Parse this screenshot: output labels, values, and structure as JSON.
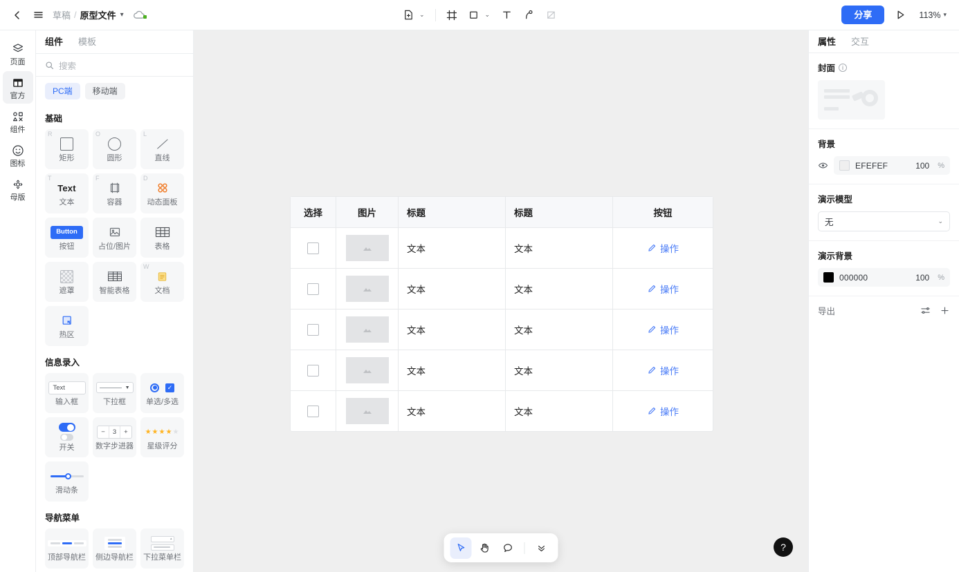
{
  "topbar": {
    "back_icon": "chevron-left-icon",
    "menu_icon": "hamburger-menu-icon",
    "breadcrumb_root": "草稿",
    "breadcrumb_sep": "/",
    "breadcrumb_current": "原型文件",
    "breadcrumb_chevron": "▾",
    "cloud_icon": "cloud-saved-icon",
    "tools": [
      {
        "name": "insert-file-icon",
        "label": "插入"
      },
      {
        "name": "frame-icon",
        "label": "画板"
      },
      {
        "name": "rectangle-icon",
        "label": "矩形"
      },
      {
        "name": "text-icon",
        "label": "文本"
      },
      {
        "name": "pen-icon",
        "label": "钢笔"
      },
      {
        "name": "slice-icon",
        "label": "切图"
      }
    ],
    "share_label": "分享",
    "preview_icon": "play-icon",
    "zoom_level": "113%",
    "zoom_chevron": "▾"
  },
  "rail": {
    "items": [
      {
        "icon": "layers-icon",
        "label": "页面",
        "active": false
      },
      {
        "icon": "official-library-icon",
        "label": "官方",
        "active": true
      },
      {
        "icon": "components-icon",
        "label": "组件",
        "active": false
      },
      {
        "icon": "smiley-icon",
        "label": "图标",
        "active": false
      },
      {
        "icon": "master-icon",
        "label": "母版",
        "active": false
      }
    ]
  },
  "panel": {
    "tabs": [
      {
        "label": "组件",
        "active": true
      },
      {
        "label": "模板",
        "active": false
      }
    ],
    "search_placeholder": "搜索",
    "search_icon": "search-icon",
    "segments": [
      {
        "label": "PC端",
        "active": true
      },
      {
        "label": "移动端",
        "active": false
      }
    ],
    "sections": [
      {
        "title": "基础",
        "items": [
          {
            "label": "矩形",
            "key": "R",
            "art": "rect"
          },
          {
            "label": "圆形",
            "key": "O",
            "art": "circle"
          },
          {
            "label": "直线",
            "key": "L",
            "art": "line"
          },
          {
            "label": "文本",
            "key": "T",
            "art": "text"
          },
          {
            "label": "容器",
            "key": "F",
            "art": "frame"
          },
          {
            "label": "动态面板",
            "key": "D",
            "art": "panel"
          },
          {
            "label": "按钮",
            "key": "",
            "art": "button"
          },
          {
            "label": "占位/图片",
            "key": "",
            "art": "image"
          },
          {
            "label": "表格",
            "key": "",
            "art": "table"
          },
          {
            "label": "遮罩",
            "key": "",
            "art": "mask"
          },
          {
            "label": "智能表格",
            "key": "",
            "art": "smarttable"
          },
          {
            "label": "文档",
            "key": "W",
            "art": "doc"
          },
          {
            "label": "热区",
            "key": "",
            "art": "hotspot"
          }
        ]
      },
      {
        "title": "信息录入",
        "items": [
          {
            "label": "输入框",
            "key": "",
            "art": "input"
          },
          {
            "label": "下拉框",
            "key": "",
            "art": "select"
          },
          {
            "label": "单选/多选",
            "key": "",
            "art": "radio-check"
          },
          {
            "label": "开关",
            "key": "",
            "art": "switch"
          },
          {
            "label": "数字步进器",
            "key": "",
            "art": "stepper"
          },
          {
            "label": "星级评分",
            "key": "",
            "art": "rating"
          },
          {
            "label": "滑动条",
            "key": "",
            "art": "slider"
          }
        ]
      },
      {
        "title": "导航菜单",
        "items": [
          {
            "label": "顶部导航栏",
            "key": "",
            "art": "navtop"
          },
          {
            "label": "侧边导航栏",
            "key": "",
            "art": "navside"
          },
          {
            "label": "下拉菜单栏",
            "key": "",
            "art": "navdrop"
          }
        ]
      }
    ],
    "stepper_value": "3",
    "input_value": "Text",
    "button_chip_label": "Button",
    "text_chip_label": "Text"
  },
  "canvas": {
    "background_color": "#EFEFEF",
    "table": {
      "headers": [
        "选择",
        "图片",
        "标题",
        "标题",
        "按钮"
      ],
      "rows": [
        {
          "checked": false,
          "image": "image-placeholder",
          "title1": "文本",
          "title2": "文本",
          "action": "操作"
        },
        {
          "checked": false,
          "image": "image-placeholder",
          "title1": "文本",
          "title2": "文本",
          "action": "操作"
        },
        {
          "checked": false,
          "image": "image-placeholder",
          "title1": "文本",
          "title2": "文本",
          "action": "操作"
        },
        {
          "checked": false,
          "image": "image-placeholder",
          "title1": "文本",
          "title2": "文本",
          "action": "操作"
        },
        {
          "checked": false,
          "image": "image-placeholder",
          "title1": "文本",
          "title2": "文本",
          "action": "操作"
        }
      ],
      "action_icon": "pencil-icon",
      "action_color": "#4A7CF7"
    },
    "floatbar": [
      {
        "icon": "cursor-icon",
        "active": true
      },
      {
        "icon": "hand-icon",
        "active": false
      },
      {
        "icon": "comment-icon",
        "active": false
      },
      {
        "icon": "chevron-double-down-icon",
        "active": false
      }
    ],
    "help_label": "?"
  },
  "inspector": {
    "tabs": [
      {
        "label": "属性",
        "active": true
      },
      {
        "label": "交互",
        "active": false
      }
    ],
    "cover": {
      "title": "封面",
      "info_icon": "info-icon",
      "thumbnail": "cover-thumbnail"
    },
    "background": {
      "title": "背景",
      "visibility_icon": "eye-icon",
      "color_hex": "EFEFEF",
      "opacity": "100",
      "opacity_unit": "%"
    },
    "present_model": {
      "title": "演示模型",
      "value": "无",
      "chevron": "⌄"
    },
    "present_background": {
      "title": "演示背景",
      "color_hex": "000000",
      "opacity": "100",
      "opacity_unit": "%"
    },
    "export": {
      "label": "导出",
      "settings_icon": "sliders-icon",
      "add_icon": "plus-icon"
    }
  }
}
